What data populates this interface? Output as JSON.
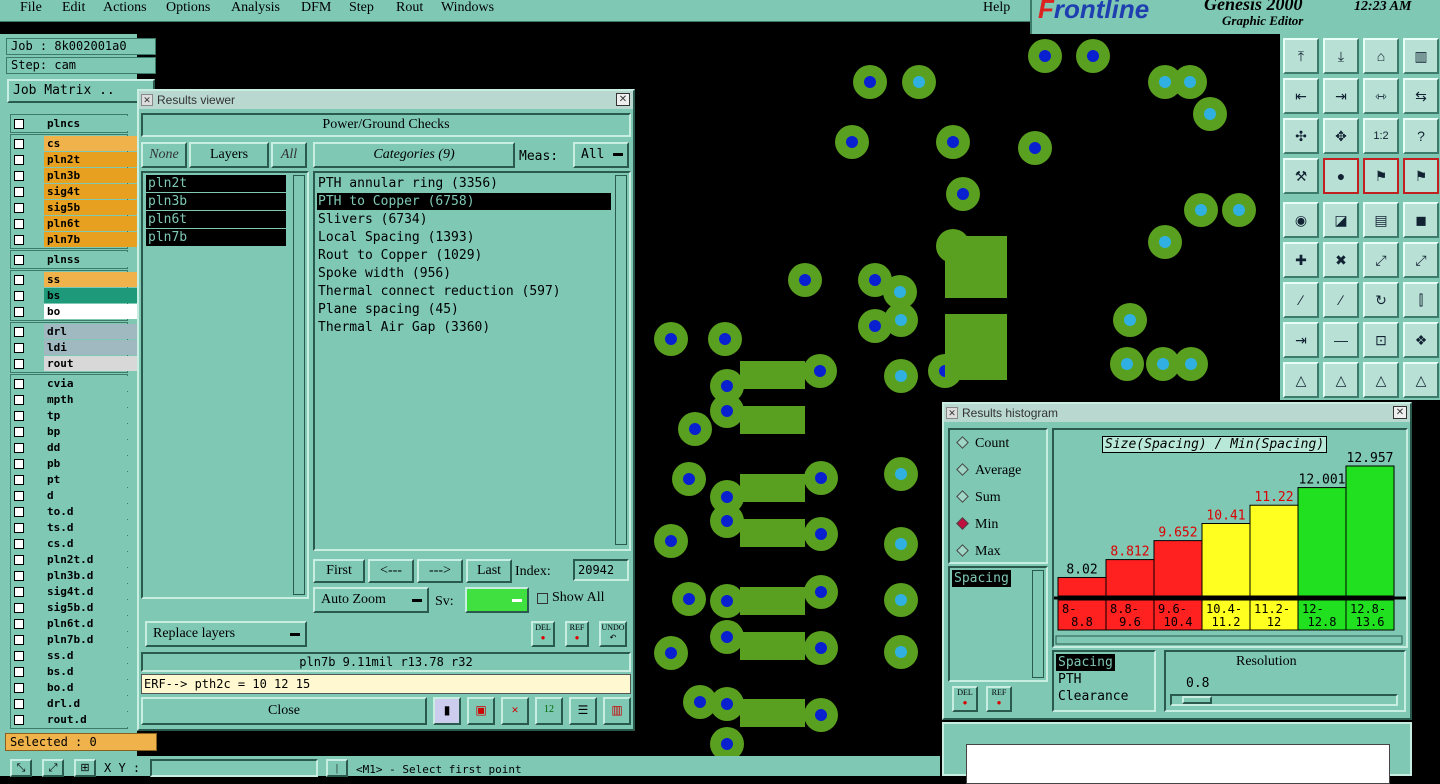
{
  "menubar": {
    "items": [
      "File",
      "Edit",
      "Actions",
      "Options",
      "Analysis",
      "DFM",
      "Step",
      "Rout",
      "Windows"
    ],
    "help": "Help"
  },
  "logo": {
    "brand_f": "F",
    "brand_rest": "rontline",
    "product": "Genesis 2000",
    "subtitle": "Graphic Editor",
    "time": "12:23  AM"
  },
  "job": {
    "job": "Job : 8k002001a0",
    "step": "Step: cam",
    "matrix": "Job Matrix .."
  },
  "layers": [
    {
      "name": "plncs",
      "color": "#7ec8b4"
    },
    {
      "name": "cs",
      "color": "#f0b24a"
    },
    {
      "name": "pln2t",
      "color": "#e8a020"
    },
    {
      "name": "pln3b",
      "color": "#e8a020"
    },
    {
      "name": "sig4t",
      "color": "#e8a020"
    },
    {
      "name": "sig5b",
      "color": "#e8a020"
    },
    {
      "name": "pln6t",
      "color": "#e8a020"
    },
    {
      "name": "pln7b",
      "color": "#e8a020"
    },
    {
      "name": "plnss",
      "color": "#7ec8b4"
    },
    {
      "name": "ss",
      "color": "#f0b24a"
    },
    {
      "name": "bs",
      "color": "#1e9a7a"
    },
    {
      "name": "bo",
      "color": "#ffffff"
    },
    {
      "name": "drl",
      "color": "#a0b8c0"
    },
    {
      "name": "ldi",
      "color": "#a0b8c0"
    },
    {
      "name": "rout",
      "color": "#d8d8d8"
    },
    {
      "name": "cvia",
      "color": "#7ec8b4"
    },
    {
      "name": "mpth",
      "color": "#7ec8b4"
    },
    {
      "name": "tp",
      "color": "#7ec8b4"
    },
    {
      "name": "bp",
      "color": "#7ec8b4"
    },
    {
      "name": "dd",
      "color": "#7ec8b4"
    },
    {
      "name": "pb",
      "color": "#7ec8b4"
    },
    {
      "name": "pt",
      "color": "#7ec8b4"
    },
    {
      "name": "d",
      "color": "#7ec8b4"
    },
    {
      "name": "to.d",
      "color": "#7ec8b4"
    },
    {
      "name": "ts.d",
      "color": "#7ec8b4"
    },
    {
      "name": "cs.d",
      "color": "#7ec8b4"
    },
    {
      "name": "pln2t.d",
      "color": "#7ec8b4"
    },
    {
      "name": "pln3b.d",
      "color": "#7ec8b4"
    },
    {
      "name": "sig4t.d",
      "color": "#7ec8b4"
    },
    {
      "name": "sig5b.d",
      "color": "#7ec8b4"
    },
    {
      "name": "pln6t.d",
      "color": "#7ec8b4"
    },
    {
      "name": "pln7b.d",
      "color": "#7ec8b4"
    },
    {
      "name": "ss.d",
      "color": "#7ec8b4"
    },
    {
      "name": "bs.d",
      "color": "#7ec8b4"
    },
    {
      "name": "bo.d",
      "color": "#7ec8b4"
    },
    {
      "name": "drl.d",
      "color": "#7ec8b4"
    },
    {
      "name": "rout.d",
      "color": "#7ec8b4"
    }
  ],
  "selected": "Selected : 0",
  "status": {
    "xy": "X Y :",
    "prompt": "<M1> - Select first point"
  },
  "results_viewer": {
    "title": "Results viewer",
    "heading": "Power/Ground Checks",
    "none": "None",
    "layers": "Layers",
    "all": "All",
    "categories_label": "Categories (9)",
    "meas_label": "Meas:",
    "meas_value": "All",
    "layer_list": [
      "pln2t",
      "pln3b",
      "pln6t",
      "pln7b"
    ],
    "categories": [
      "PTH annular ring (3356)",
      "PTH to Copper (6758)",
      "Slivers (6734)",
      "Local Spacing (1393)",
      "Rout to Copper (1029)",
      "Spoke width (956)",
      "Thermal connect reduction (597)",
      "Plane spacing (45)",
      "Thermal Air Gap (3360)"
    ],
    "selected_category": "PTH to Copper (6758)",
    "nav": {
      "first": "First",
      "prev": "<---",
      "next": "--->",
      "last": "Last",
      "index_label": "Index:",
      "index_value": "20942"
    },
    "auto_zoom": "Auto Zoom",
    "sv_label": "Sv:",
    "show_all": "Show All",
    "replace_layers": "Replace layers",
    "mini_buttons": [
      "DEL",
      "REF",
      "UNDO"
    ],
    "info_line": "pln7b 9.11mil  r13.78  r32",
    "erf_line": "ERF--> pth2c = 10 12 15",
    "close": "Close"
  },
  "histogram": {
    "title": "Results histogram",
    "modes": [
      "Count",
      "Average",
      "Sum",
      "Min",
      "Max"
    ],
    "selected_mode": "Min",
    "chart_title": "Size(Spacing) / Min(Spacing)",
    "list_item": "Spacing",
    "list2": [
      "Spacing",
      "PTH",
      "Clearance"
    ],
    "resolution_label": "Resolution",
    "resolution_value": "0.8",
    "buttons": [
      "DEL",
      "REF"
    ]
  },
  "chart_data": {
    "type": "bar",
    "title": "Size(Spacing) / Min(Spacing)",
    "categories": [
      "8-8.8",
      "8.8-9.6",
      "9.6-10.4",
      "10.4-11.2",
      "11.2-12",
      "12-12.8",
      "12.8-13.6"
    ],
    "cat_top": [
      "8-",
      "8.8-",
      "9.6-",
      "10.4-",
      "11.2-",
      "12-",
      "12.8-"
    ],
    "cat_bot": [
      "8.8",
      "9.6",
      "10.4",
      "11.2",
      "12",
      "12.8",
      "13.6"
    ],
    "values": [
      8.02,
      8.812,
      9.652,
      10.41,
      11.22,
      12.001,
      12.957
    ],
    "colors": [
      "#ff2020",
      "#ff2020",
      "#ff2020",
      "#ffff20",
      "#ffff20",
      "#20e020",
      "#20e020"
    ],
    "label_colors": [
      "#000",
      "#d00",
      "#d00",
      "#d00",
      "#d00",
      "#000",
      "#000"
    ]
  }
}
